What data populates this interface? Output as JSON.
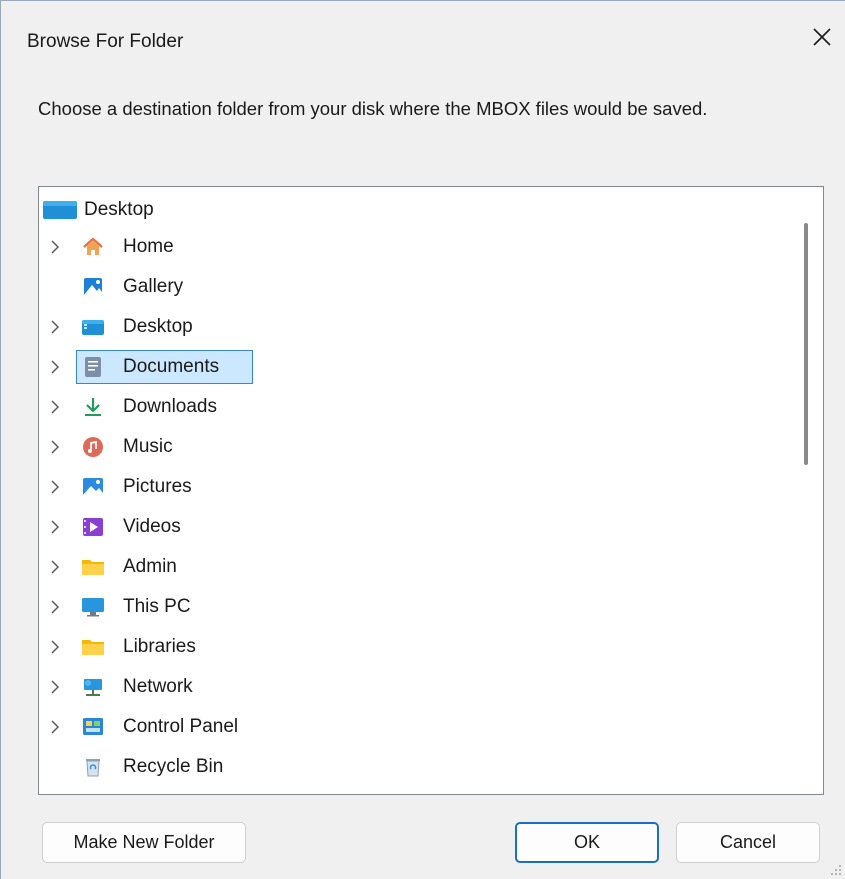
{
  "window": {
    "title": "Browse For Folder",
    "close_label": "✕"
  },
  "prompt": "Choose a destination folder from your disk where the MBOX files would be saved.",
  "tree": {
    "root": {
      "label": "Desktop",
      "icon": "desktop-folder-icon"
    },
    "items": [
      {
        "label": "Home",
        "icon": "home-icon",
        "expandable": true,
        "selected": false
      },
      {
        "label": "Gallery",
        "icon": "gallery-icon",
        "expandable": false,
        "selected": false
      },
      {
        "label": "Desktop",
        "icon": "desktop-folder-icon",
        "expandable": true,
        "selected": false
      },
      {
        "label": "Documents",
        "icon": "documents-icon",
        "expandable": true,
        "selected": true
      },
      {
        "label": "Downloads",
        "icon": "downloads-icon",
        "expandable": true,
        "selected": false
      },
      {
        "label": "Music",
        "icon": "music-icon",
        "expandable": true,
        "selected": false
      },
      {
        "label": "Pictures",
        "icon": "pictures-icon",
        "expandable": true,
        "selected": false
      },
      {
        "label": "Videos",
        "icon": "videos-icon",
        "expandable": true,
        "selected": false
      },
      {
        "label": "Admin",
        "icon": "folder-icon",
        "expandable": true,
        "selected": false
      },
      {
        "label": "This PC",
        "icon": "this-pc-icon",
        "expandable": true,
        "selected": false
      },
      {
        "label": "Libraries",
        "icon": "folder-icon",
        "expandable": true,
        "selected": false
      },
      {
        "label": "Network",
        "icon": "network-icon",
        "expandable": true,
        "selected": false
      },
      {
        "label": "Control Panel",
        "icon": "control-panel-icon",
        "expandable": true,
        "selected": false
      },
      {
        "label": "Recycle Bin",
        "icon": "recycle-bin-icon",
        "expandable": false,
        "selected": false
      }
    ]
  },
  "buttons": {
    "make_new_folder": "Make New Folder",
    "ok": "OK",
    "cancel": "Cancel"
  },
  "colors": {
    "selection_fill": "#cce8ff",
    "selection_border": "#3b86c6",
    "default_button_border": "#1a6fc4"
  }
}
